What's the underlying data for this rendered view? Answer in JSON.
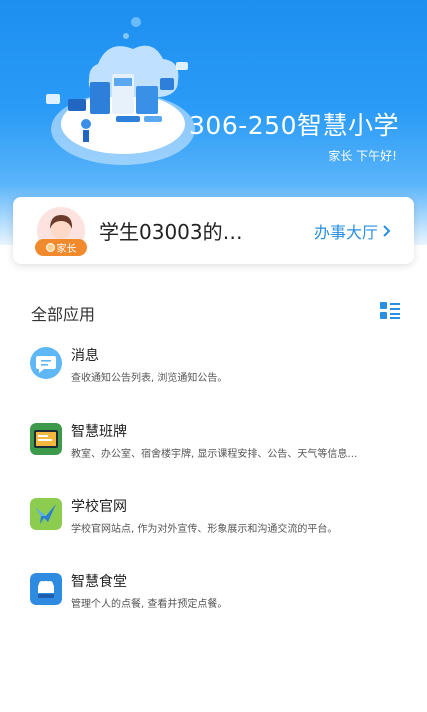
{
  "header": {
    "school_name": "306-250智慧小学",
    "greeting": "家长 下午好!"
  },
  "profile": {
    "student_name": "学生03003的…",
    "role_badge": "家长",
    "office_link_label": "办事大厅"
  },
  "section": {
    "title": "全部应用"
  },
  "apps": [
    {
      "title": "消息",
      "desc": "查收通知公告列表, 浏览通知公告。",
      "icon": "message-icon"
    },
    {
      "title": "智慧班牌",
      "desc": "教室、办公室、宿舍楼宇牌, 显示课程安排、公告、天气等信息…",
      "icon": "class-board-icon"
    },
    {
      "title": "学校官网",
      "desc": "学校官网站点, 作为对外宣传、形象展示和沟通交流的平台。",
      "icon": "school-website-icon"
    },
    {
      "title": "智慧食堂",
      "desc": "管理个人的点餐, 查看并预定点餐。",
      "icon": "canteen-icon"
    }
  ],
  "colors": {
    "header_blue": "#1d8ff0",
    "link_blue": "#2a8fe0",
    "badge_orange": "#f08a2c"
  }
}
